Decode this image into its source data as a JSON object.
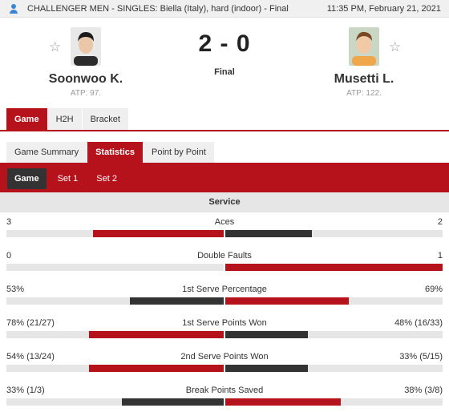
{
  "header": {
    "icon": "person-icon",
    "tournament": "CHALLENGER MEN - SINGLES: Biella (Italy), hard (indoor) - Final",
    "datetime": "11:35 PM, February 21, 2021"
  },
  "match": {
    "home": {
      "name": "Soonwoo K.",
      "rank": "ATP: 97."
    },
    "away": {
      "name": "Musetti L.",
      "rank": "ATP: 122."
    },
    "score": "2 - 0",
    "status": "Final",
    "star_icon": "☆"
  },
  "tabs": {
    "main": [
      "Game",
      "H2H",
      "Bracket"
    ],
    "main_active": 0,
    "sub": [
      "Game Summary",
      "Statistics",
      "Point by Point"
    ],
    "sub_active": 1,
    "periods": [
      "Game",
      "Set 1",
      "Set 2"
    ],
    "period_active": 0
  },
  "section": "Service",
  "colors": {
    "accent": "#b5121b",
    "dark": "#333333",
    "track": "#e6e6e6"
  },
  "stats": [
    {
      "name": "Aces",
      "home": "3",
      "away": "2",
      "home_share": 0.6,
      "away_share": 0.4,
      "home_leader": true
    },
    {
      "name": "Double Faults",
      "home": "0",
      "away": "1",
      "home_share": 0.0,
      "away_share": 1.0,
      "home_leader": false
    },
    {
      "name": "1st Serve Percentage",
      "home": "53%",
      "away": "69%",
      "home_share": 0.43,
      "away_share": 0.57,
      "home_leader": false
    },
    {
      "name": "1st Serve Points Won",
      "home": "78% (21/27)",
      "away": "48% (16/33)",
      "home_share": 0.62,
      "away_share": 0.38,
      "home_leader": true
    },
    {
      "name": "2nd Serve Points Won",
      "home": "54% (13/24)",
      "away": "33% (5/15)",
      "home_share": 0.62,
      "away_share": 0.38,
      "home_leader": true
    },
    {
      "name": "Break Points Saved",
      "home": "33% (1/3)",
      "away": "38% (3/8)",
      "home_share": 0.47,
      "away_share": 0.53,
      "home_leader": false
    }
  ]
}
